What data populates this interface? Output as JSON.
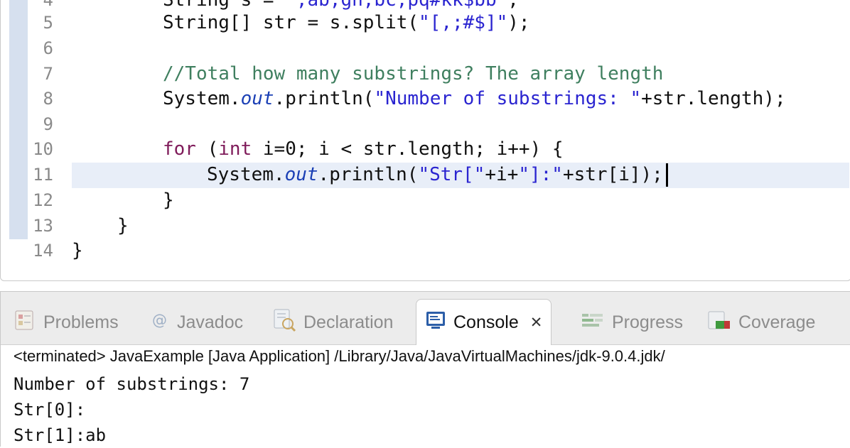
{
  "editor": {
    "lines": [
      {
        "num": "5",
        "code": "String[] str = s.split(\"[,;#$]\");"
      },
      {
        "num": "6",
        "code": ""
      },
      {
        "num": "7",
        "code": "//Total how many substrings? The array length"
      },
      {
        "num": "8",
        "code": "System.out.println(\"Number of substrings: \"+str.length);"
      },
      {
        "num": "9",
        "code": ""
      },
      {
        "num": "10",
        "code": "for (int i=0; i < str.length; i++) {"
      },
      {
        "num": "11",
        "code": "System.out.println(\"Str[\"+i+\"]:\"+str[i]);"
      },
      {
        "num": "12",
        "code": "}"
      },
      {
        "num": "13",
        "code": "}"
      },
      {
        "num": "14",
        "code": "}"
      }
    ]
  },
  "views": {
    "tabs": [
      {
        "label": "Problems",
        "icon": "problems-icon"
      },
      {
        "label": "Javadoc",
        "icon": "javadoc-icon"
      },
      {
        "label": "Declaration",
        "icon": "declaration-icon"
      },
      {
        "label": "Console",
        "icon": "console-icon",
        "active": true
      },
      {
        "label": "Progress",
        "icon": "progress-icon"
      },
      {
        "label": "Coverage",
        "icon": "coverage-icon"
      }
    ],
    "close_glyph": "✕",
    "console": {
      "status": "<terminated> JavaExample [Java Application] /Library/Java/JavaVirtualMachines/jdk-9.0.4.jdk/",
      "output": [
        "Number of substrings: 7",
        "Str[0]:",
        "Str[1]:ab"
      ]
    }
  },
  "colors": {
    "keyword": "#7f1b5a",
    "string": "#2a24d0",
    "comment": "#3f7f5f",
    "static_field": "#1a3fb5",
    "current_line": "#e8eef8",
    "change_bar": "#d6e0ef"
  }
}
